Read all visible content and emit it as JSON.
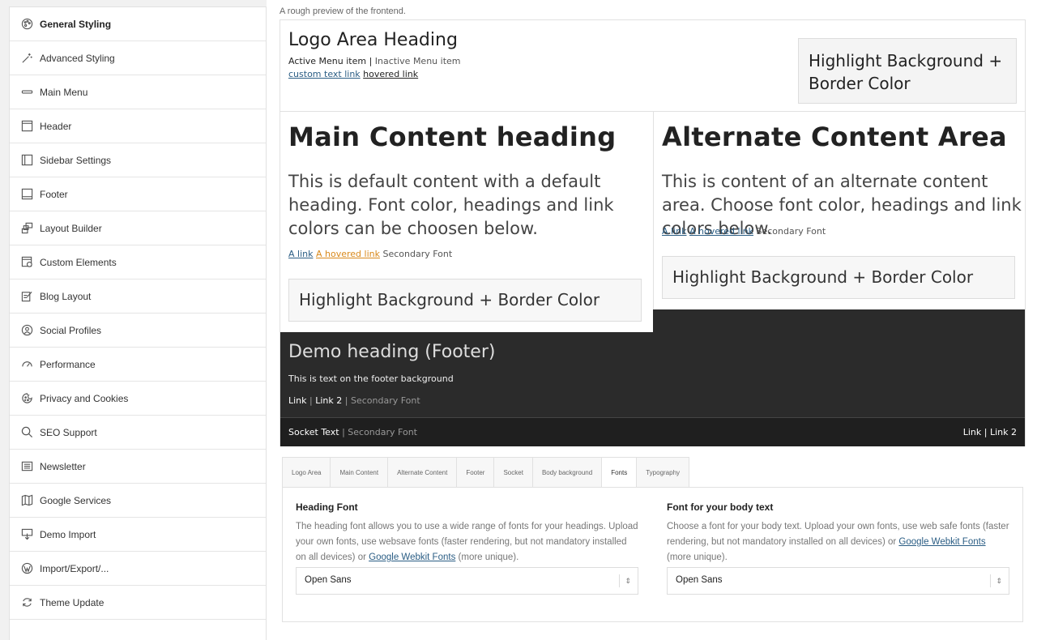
{
  "sidebar": {
    "items": [
      {
        "label": "General Styling",
        "icon": "palette-icon",
        "active": true
      },
      {
        "label": "Advanced Styling",
        "icon": "magic-wand-icon"
      },
      {
        "label": "Main Menu",
        "icon": "menu-bar-icon"
      },
      {
        "label": "Header",
        "icon": "header-layout-icon"
      },
      {
        "label": "Sidebar Settings",
        "icon": "sidebar-layout-icon"
      },
      {
        "label": "Footer",
        "icon": "footer-layout-icon"
      },
      {
        "label": "Layout Builder",
        "icon": "layout-builder-icon"
      },
      {
        "label": "Custom Elements",
        "icon": "custom-elements-icon"
      },
      {
        "label": "Blog Layout",
        "icon": "blog-edit-icon"
      },
      {
        "label": "Social Profiles",
        "icon": "social-profile-icon"
      },
      {
        "label": "Performance",
        "icon": "speedometer-icon"
      },
      {
        "label": "Privacy and Cookies",
        "icon": "cookie-icon"
      },
      {
        "label": "SEO Support",
        "icon": "search-icon"
      },
      {
        "label": "Newsletter",
        "icon": "newsletter-icon"
      },
      {
        "label": "Google Services",
        "icon": "book-map-icon"
      },
      {
        "label": "Demo Import",
        "icon": "import-icon"
      },
      {
        "label": "Import/Export/...",
        "icon": "wordpress-icon"
      },
      {
        "label": "Theme Update",
        "icon": "refresh-icon"
      }
    ]
  },
  "preview": {
    "caption": "A rough preview of the frontend.",
    "logo_heading": "Logo Area Heading",
    "active_menu": "Active Menu item",
    "menu_sep": "|",
    "inactive_menu": "Inactive Menu item",
    "custom_link": "custom text link",
    "hovered_link": "hovered link",
    "highlight_top": "Highlight Background + Border Color",
    "main_heading": "Main Content heading",
    "main_text": "This is default content with a default heading. Font color, headings and link colors can be choosen below.",
    "main_link": "A link",
    "main_hovered": "A hovered link",
    "secondary_font": "Secondary Font",
    "main_highlight": "Highlight Background + Border Color",
    "alt_heading": "Alternate Content Area",
    "alt_text": "This is content of an alternate content area. Choose font color, headings and link colors below.",
    "alt_link": "A link",
    "alt_hovered": "A hovered link",
    "alt_highlight": "Highlight Background + Border Color",
    "footer_heading": "Demo heading (Footer)",
    "footer_text": "This is text on the footer background",
    "footer_link1": "Link",
    "footer_link2": "Link 2",
    "socket_text": "Socket Text",
    "socket_link1": "Link",
    "socket_link2": "Link 2"
  },
  "tabs": [
    "Logo Area",
    "Main Content",
    "Alternate Content",
    "Footer",
    "Socket",
    "Body background",
    "Fonts",
    "Typography"
  ],
  "active_tab": "Fonts",
  "fonts_panel": {
    "heading_title": "Heading Font",
    "heading_desc": "The heading font allows you to use a wide range of fonts for your headings. Upload your own fonts, use websave fonts (faster rendering, but not mandatory installed on all devices) or",
    "heading_link": "Google Webkit Fonts",
    "heading_suffix": "(more unique).",
    "heading_value": "Open Sans",
    "body_title": "Font for your body text",
    "body_desc": "Choose a font for your body text. Upload your own fonts, use web safe fonts (faster rendering, but not mandatory installed on all devices) or",
    "body_link": "Google Webkit Fonts",
    "body_suffix": "(more unique).",
    "body_value": "Open Sans"
  },
  "colors": {
    "link": "#2a5d84",
    "hover_orange": "#d9891b",
    "footer_bg": "#2b2b2b",
    "socket_bg": "#1f1f1f"
  }
}
